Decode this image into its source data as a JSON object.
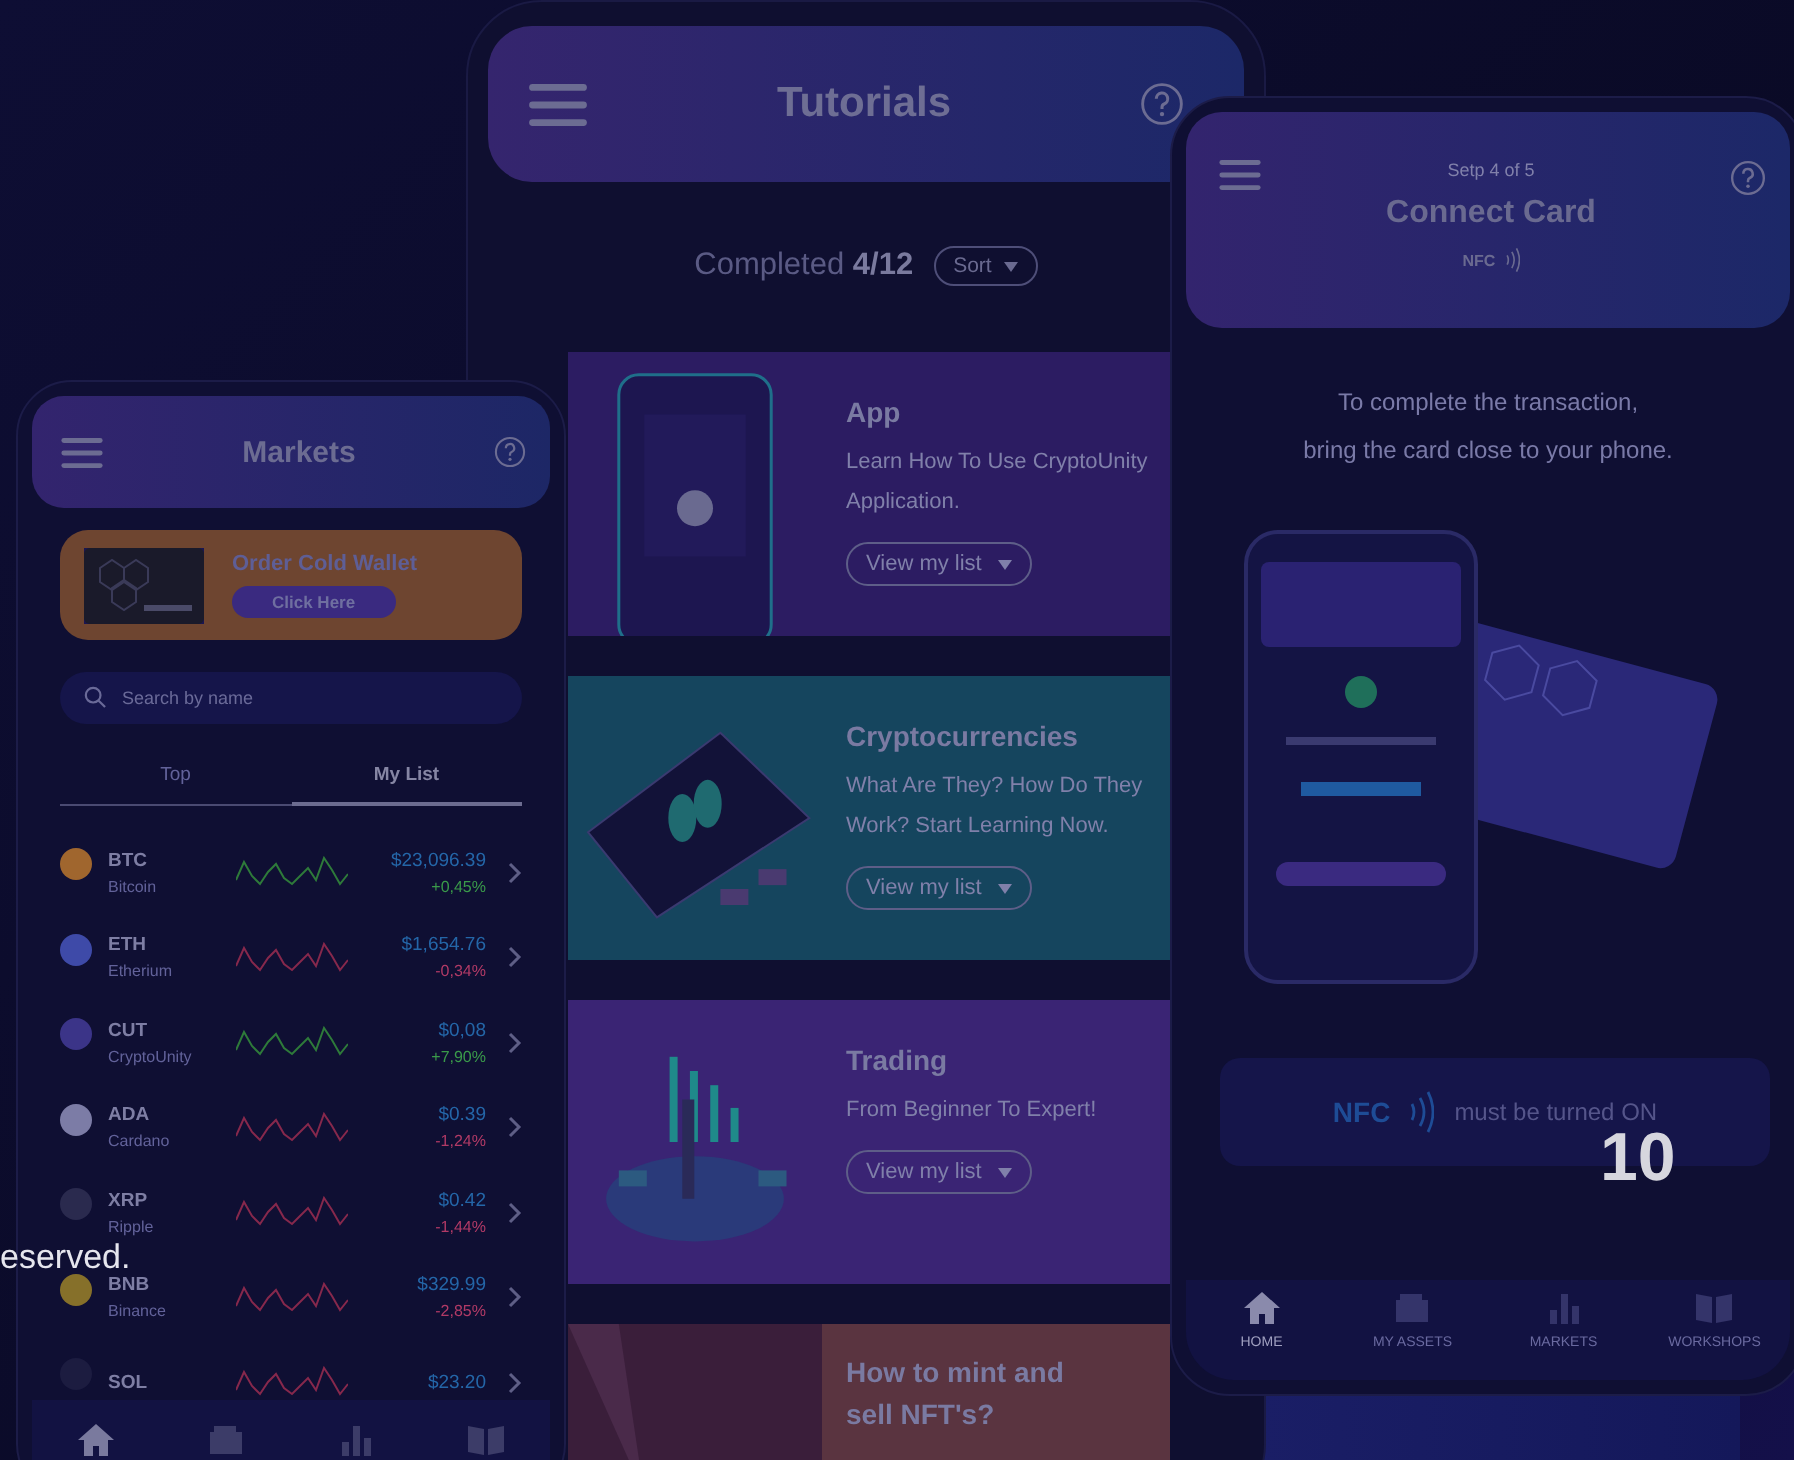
{
  "markets": {
    "title": "Markets",
    "promo": {
      "title": "Order Cold Wallet",
      "button": "Click Here"
    },
    "search": {
      "placeholder": "Search by name"
    },
    "tabs": [
      {
        "label": "Top",
        "selected": false
      },
      {
        "label": "My List",
        "selected": true
      }
    ],
    "coins": [
      {
        "symbol": "BTC",
        "name": "Bitcoin",
        "price": "$23,096.39",
        "change": "+0,45%",
        "rising": true,
        "color": "#a0662e"
      },
      {
        "symbol": "ETH",
        "name": "Etherium",
        "price": "$1,654.76",
        "change": "-0,34%",
        "rising": false,
        "color": "#3e4aa8"
      },
      {
        "symbol": "CUT",
        "name": "CryptoUnity",
        "price": "$0,08",
        "change": "+7,90%",
        "rising": true,
        "color": "#3b3488"
      },
      {
        "symbol": "ADA",
        "name": "Cardano",
        "price": "$0.39",
        "change": "-1,24%",
        "rising": false,
        "color": "#7c7ca6"
      },
      {
        "symbol": "XRP",
        "name": "Ripple",
        "price": "$0.42",
        "change": "-1,44%",
        "rising": false,
        "color": "#2a2a4e"
      },
      {
        "symbol": "BNB",
        "name": "Binance",
        "price": "$329.99",
        "change": "-2,85%",
        "rising": false,
        "color": "#86702a"
      },
      {
        "symbol": "SOL",
        "price": "$23.20",
        "rising": false,
        "color": "#1c1c40"
      }
    ]
  },
  "tutorials": {
    "title": "Tutorials",
    "progress": "Completed **4/12**",
    "sort_button": "Sort",
    "cards": [
      {
        "title": "App",
        "description": "Learn How To Use CryptoUnity Application.",
        "button": "View my list",
        "color": "#2c1c62"
      },
      {
        "title": "Cryptocurrencies",
        "description": "What Are They? How Do They Work? Start Learning Now.",
        "button": "View my list",
        "color": "#15455e"
      },
      {
        "title": "Trading",
        "description": "From Beginner To Expert!",
        "button": "View my list",
        "color": "#3a2474"
      },
      {
        "title": "How to mint and sell NFT's?",
        "color": "#5a3440"
      }
    ]
  },
  "connect_card": {
    "step": "Setp 4 of 5",
    "title": "Connect Card",
    "nfc_label": "NFC",
    "instructions": "To complete the transaction,\nbring the card close to your phone.",
    "notice": {
      "nfc": "NFC",
      "text": "must be turned ON"
    },
    "nav": [
      {
        "label": "HOME",
        "selected": true
      },
      {
        "label": "MY ASSETS",
        "selected": false
      },
      {
        "label": "MARKETS",
        "selected": false
      },
      {
        "label": "WORKSHOPS",
        "selected": false
      }
    ]
  },
  "footer_text": "eserved.",
  "slide_number": "10"
}
